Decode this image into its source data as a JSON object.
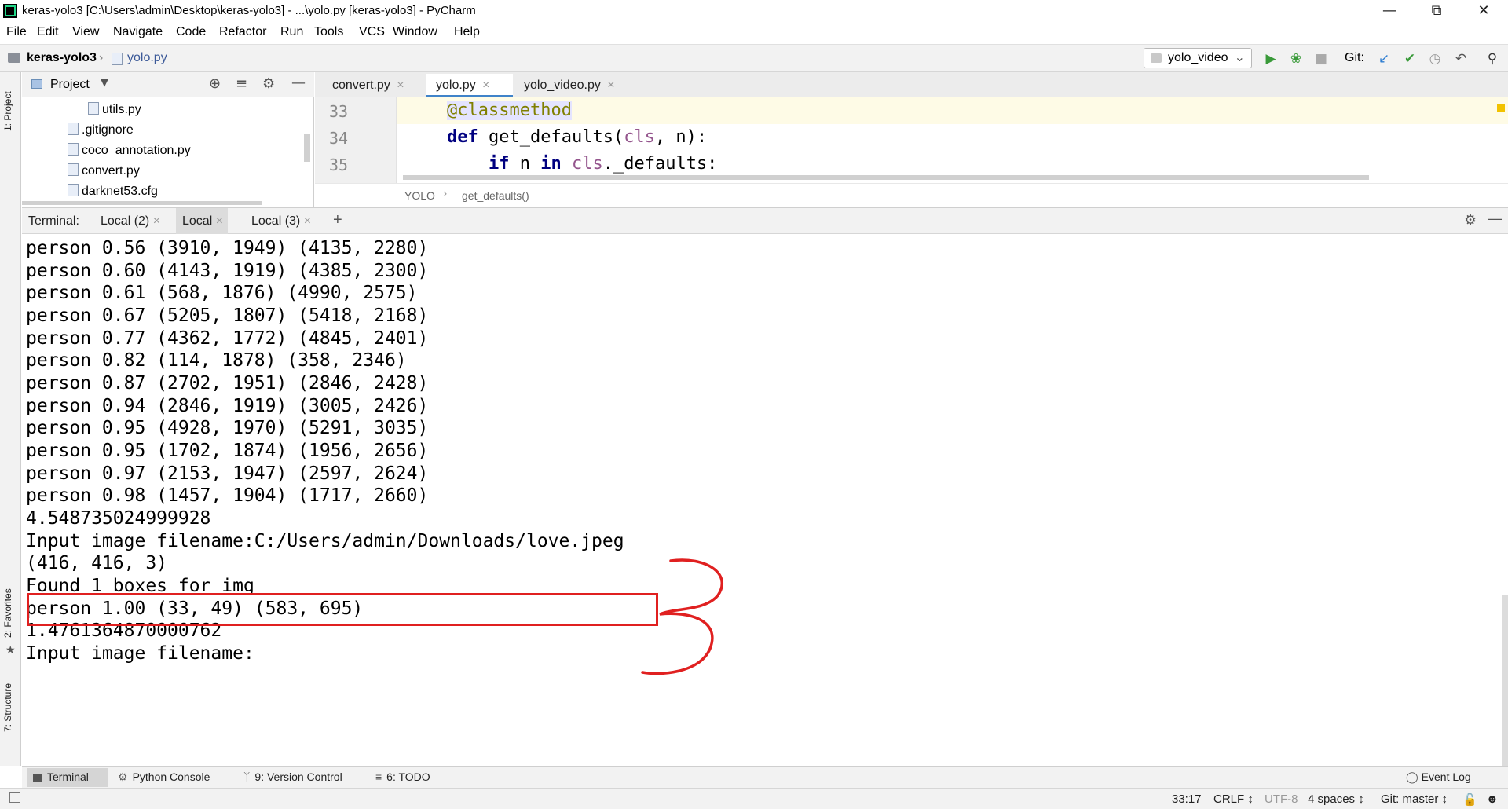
{
  "window": {
    "title": "keras-yolo3 [C:\\Users\\admin\\Desktop\\keras-yolo3] - ...\\yolo.py [keras-yolo3] - PyCharm"
  },
  "menu": [
    "File",
    "Edit",
    "View",
    "Navigate",
    "Code",
    "Refactor",
    "Run",
    "Tools",
    "VCS",
    "Window",
    "Help"
  ],
  "breadcrumb": {
    "project": "keras-yolo3",
    "file": "yolo.py"
  },
  "toolbar": {
    "run_config": "yolo_video",
    "git_label": "Git:"
  },
  "left_strip": {
    "project_tab": "1: Project",
    "favorites_tab": "2: Favorites",
    "structure_tab": "7: Structure"
  },
  "project_panel": {
    "title": "Project",
    "files": [
      {
        "name": "utils.py",
        "indent": 2
      },
      {
        "name": ".gitignore",
        "indent": 1
      },
      {
        "name": "coco_annotation.py",
        "indent": 1
      },
      {
        "name": "convert.py",
        "indent": 1
      },
      {
        "name": "darknet53.cfg",
        "indent": 1
      }
    ]
  },
  "editor": {
    "tabs": [
      {
        "label": "convert.py",
        "active": false
      },
      {
        "label": "yolo.py",
        "active": true
      },
      {
        "label": "yolo_video.py",
        "active": false
      }
    ],
    "line_numbers": [
      "33",
      "34",
      "35"
    ],
    "breadcrumb_class": "YOLO",
    "breadcrumb_method": "get_defaults()"
  },
  "terminal": {
    "label": "Terminal:",
    "tabs": [
      {
        "label": "Local (2)",
        "active": false
      },
      {
        "label": "Local",
        "active": true
      },
      {
        "label": "Local (3)",
        "active": false
      }
    ],
    "lines": [
      "person 0.56 (3910, 1949) (4135, 2280)",
      "person 0.60 (4143, 1919) (4385, 2300)",
      "person 0.61 (568, 1876) (4990, 2575)",
      "person 0.67 (5205, 1807) (5418, 2168)",
      "person 0.77 (4362, 1772) (4845, 2401)",
      "person 0.82 (114, 1878) (358, 2346)",
      "person 0.87 (2702, 1951) (2846, 2428)",
      "person 0.94 (2846, 1919) (3005, 2426)",
      "person 0.95 (4928, 1970) (5291, 3035)",
      "person 0.95 (1702, 1874) (1956, 2656)",
      "person 0.97 (2153, 1947) (2597, 2624)",
      "person 0.98 (1457, 1904) (1717, 2660)",
      "4.548735024999928",
      "Input image filename:C:/Users/admin/Downloads/love.jpeg",
      "(416, 416, 3)",
      "Found 1 boxes for img",
      "person 1.00 (33, 49) (583, 695)",
      "1.4761364870000762",
      "Input image filename:"
    ]
  },
  "bottom_tools": [
    "Terminal",
    "Python Console",
    "9: Version Control",
    "6: TODO"
  ],
  "event_log": "Event Log",
  "status": {
    "position": "33:17",
    "line_sep": "CRLF ↕",
    "encoding": "UTF-8",
    "indent": "4 spaces ↕",
    "git_branch": "Git: master ↕"
  },
  "colors": {
    "annotation_red": "#e02020",
    "keyword": "#000080",
    "decorator": "#808000",
    "param": "#94558d"
  }
}
